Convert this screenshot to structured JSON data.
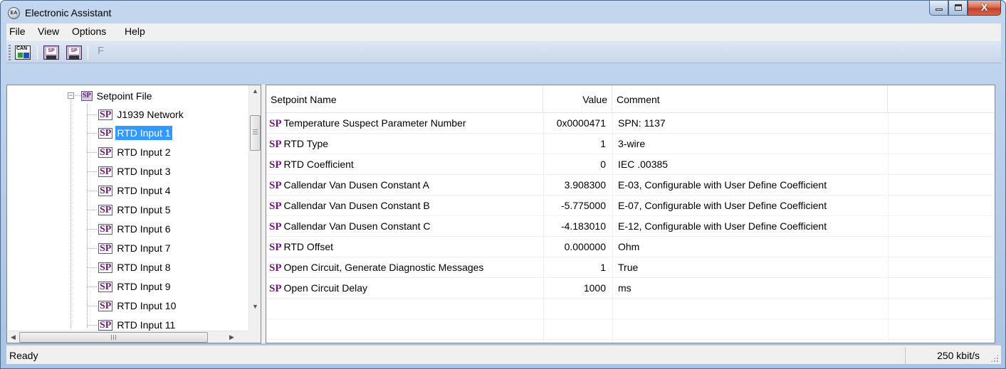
{
  "window": {
    "title": "Electronic Assistant",
    "icon_text": "EA"
  },
  "window_buttons": {
    "close_glyph": "X"
  },
  "menu": [
    "File",
    "View",
    "Options",
    "Help"
  ],
  "toolbar": {
    "buttons": [
      {
        "name": "can-connect-icon",
        "text": "CAN"
      },
      {
        "name": "setpoint-open-icon",
        "text": "SP"
      },
      {
        "name": "setpoint-save-icon",
        "text": "SP"
      }
    ],
    "f_label": "F"
  },
  "tree": {
    "root": {
      "label": "Setpoint File",
      "badge": "SP",
      "expander": "−"
    },
    "items": [
      {
        "badge": "SP",
        "label": "J1939 Network"
      },
      {
        "badge": "SP",
        "label": "RTD Input 1",
        "selected": true
      },
      {
        "badge": "SP",
        "label": "RTD Input 2"
      },
      {
        "badge": "SP",
        "label": "RTD Input 3"
      },
      {
        "badge": "SP",
        "label": "RTD Input 4"
      },
      {
        "badge": "SP",
        "label": "RTD Input 5"
      },
      {
        "badge": "SP",
        "label": "RTD Input 6"
      },
      {
        "badge": "SP",
        "label": "RTD Input 7"
      },
      {
        "badge": "SP",
        "label": "RTD Input 8"
      },
      {
        "badge": "SP",
        "label": "RTD Input 9"
      },
      {
        "badge": "SP",
        "label": "RTD Input 10"
      },
      {
        "badge": "SP",
        "label": "RTD Input 11"
      }
    ],
    "scroll": {
      "up": "▲",
      "down": "▼",
      "left": "◀",
      "right": "▶"
    }
  },
  "list": {
    "columns": {
      "name": "Setpoint Name",
      "value": "Value",
      "comment": "Comment"
    },
    "tag": "SP",
    "rows": [
      {
        "name": "Temperature Suspect Parameter Number",
        "value": "0x0000471",
        "comment": "SPN: 1137"
      },
      {
        "name": "RTD Type",
        "value": "1",
        "comment": "3-wire"
      },
      {
        "name": "RTD Coefficient",
        "value": "0",
        "comment": "IEC .00385"
      },
      {
        "name": "Callendar Van Dusen Constant A",
        "value": "3.908300",
        "comment": "E-03, Configurable with User Define Coefficient"
      },
      {
        "name": "Callendar Van Dusen Constant B",
        "value": "-5.775000",
        "comment": "E-07, Configurable with User Define Coefficient"
      },
      {
        "name": "Callendar Van Dusen Constant C",
        "value": "-4.183010",
        "comment": "E-12, Configurable with User Define Coefficient"
      },
      {
        "name": "RTD Offset",
        "value": "0.000000",
        "comment": "Ohm"
      },
      {
        "name": "Open Circuit, Generate Diagnostic Messages",
        "value": "1",
        "comment": "True"
      },
      {
        "name": "Open Circuit Delay",
        "value": "1000",
        "comment": "ms"
      }
    ]
  },
  "status": {
    "text": "Ready",
    "baud": "250 kbit/s"
  }
}
